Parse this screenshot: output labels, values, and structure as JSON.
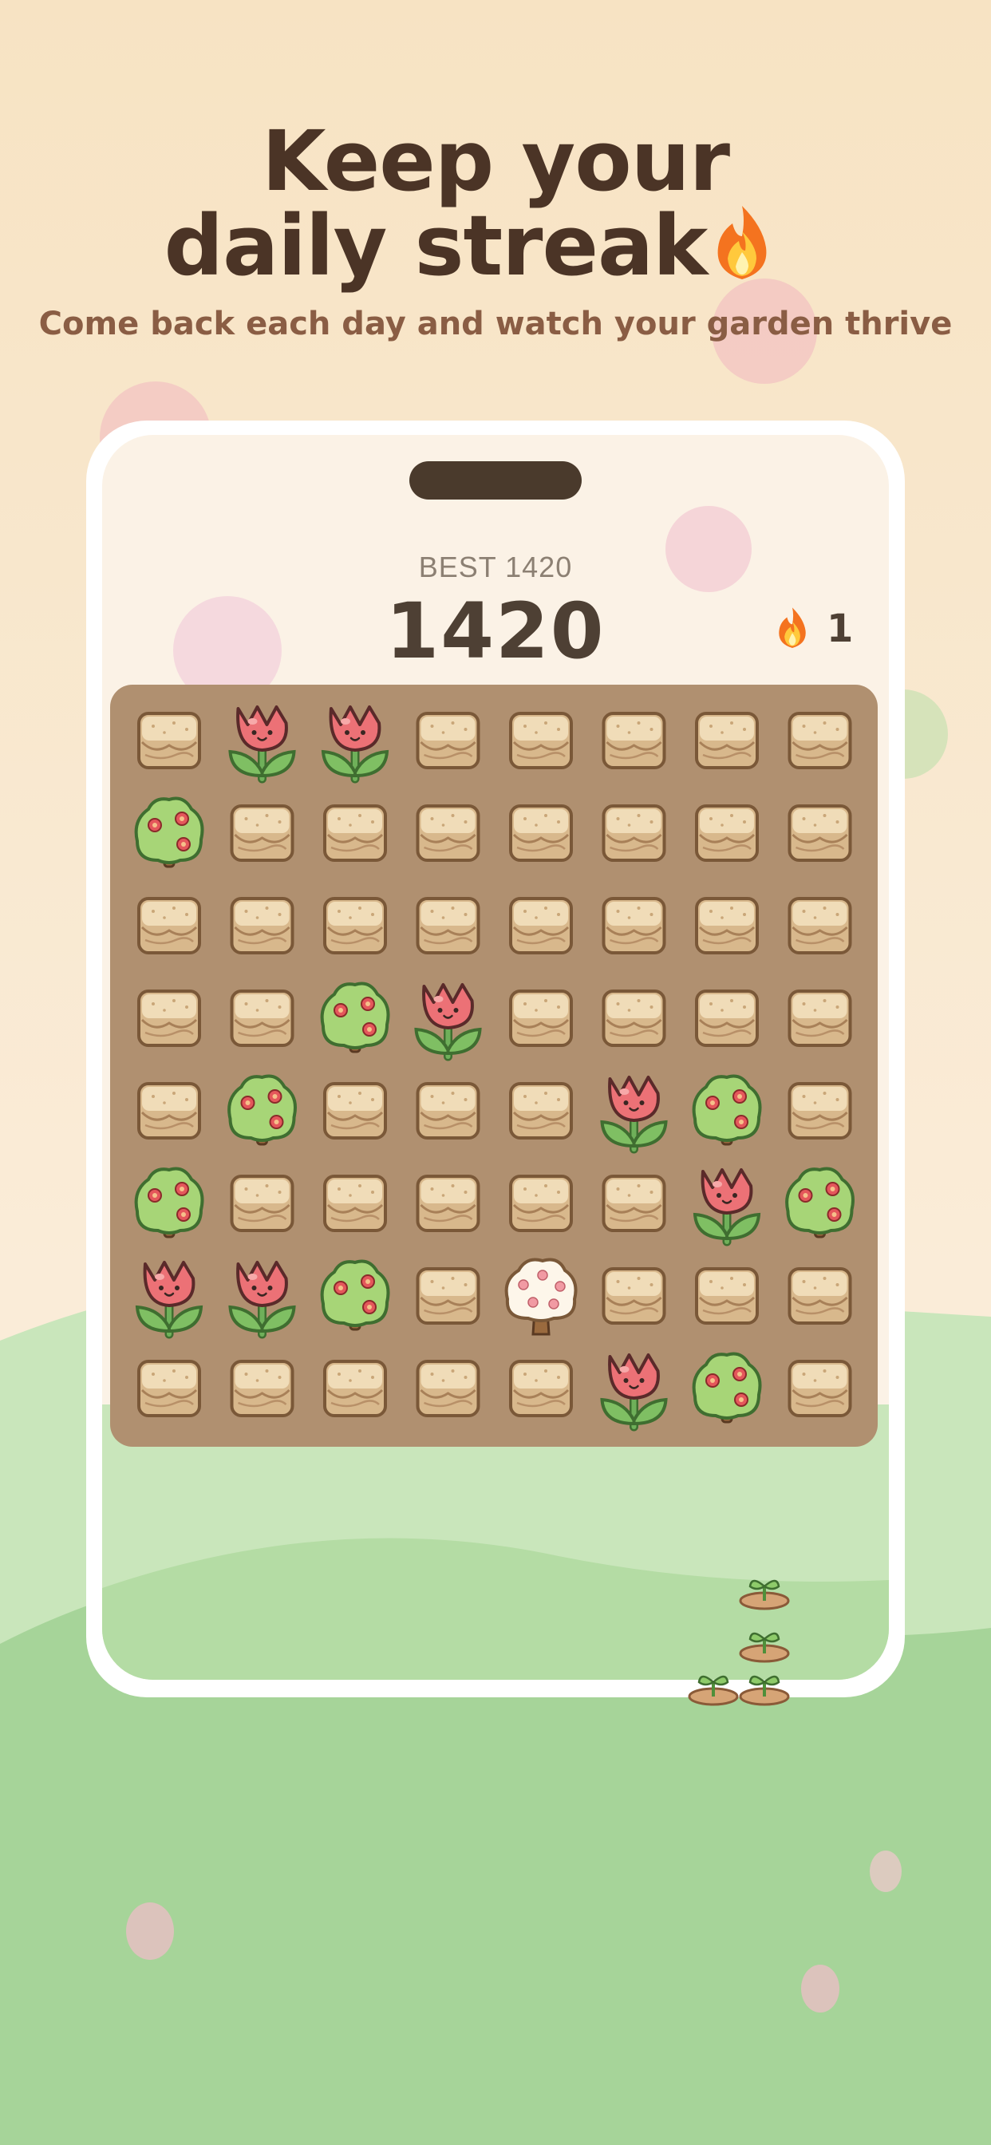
{
  "header": {
    "title_line1": "Keep your",
    "title_line2": "daily streak",
    "title_emoji_icon": "fire-icon",
    "subtitle": "Come back each day and watch your garden thrive"
  },
  "game": {
    "best_label": "BEST 1420",
    "score": "1420",
    "streak_icon": "fire-icon",
    "streak_count": "1",
    "board": {
      "rows": 8,
      "cols": 8,
      "tiles": [
        [
          "dirt",
          "tulip",
          "tulip",
          "dirt",
          "dirt",
          "dirt",
          "dirt",
          "dirt"
        ],
        [
          "bush",
          "dirt",
          "dirt",
          "dirt",
          "dirt",
          "dirt",
          "dirt",
          "dirt"
        ],
        [
          "dirt",
          "dirt",
          "dirt",
          "dirt",
          "dirt",
          "dirt",
          "dirt",
          "dirt"
        ],
        [
          "dirt",
          "dirt",
          "bush",
          "tulip",
          "dirt",
          "dirt",
          "dirt",
          "dirt"
        ],
        [
          "dirt",
          "bush",
          "dirt",
          "dirt",
          "dirt",
          "tulip",
          "bush",
          "dirt"
        ],
        [
          "bush",
          "dirt",
          "dirt",
          "dirt",
          "dirt",
          "dirt",
          "tulip",
          "bush"
        ],
        [
          "tulip",
          "tulip",
          "bush",
          "dirt",
          "tree",
          "dirt",
          "dirt",
          "dirt"
        ],
        [
          "dirt",
          "dirt",
          "dirt",
          "dirt",
          "dirt",
          "tulip",
          "bush",
          "dirt"
        ]
      ]
    },
    "sprouts": [
      "sprout-icon",
      "sprout-icon",
      "sprout-icon",
      "sprout-icon"
    ]
  },
  "colors": {
    "background_top": "#f7e3c3",
    "hill_green": "#a6d499",
    "board_brown": "#b09070",
    "text_dark": "#4b3426",
    "subtitle": "#8a5d44",
    "tulip_red": "#e86a6f",
    "leaf_green": "#6fb05a"
  }
}
